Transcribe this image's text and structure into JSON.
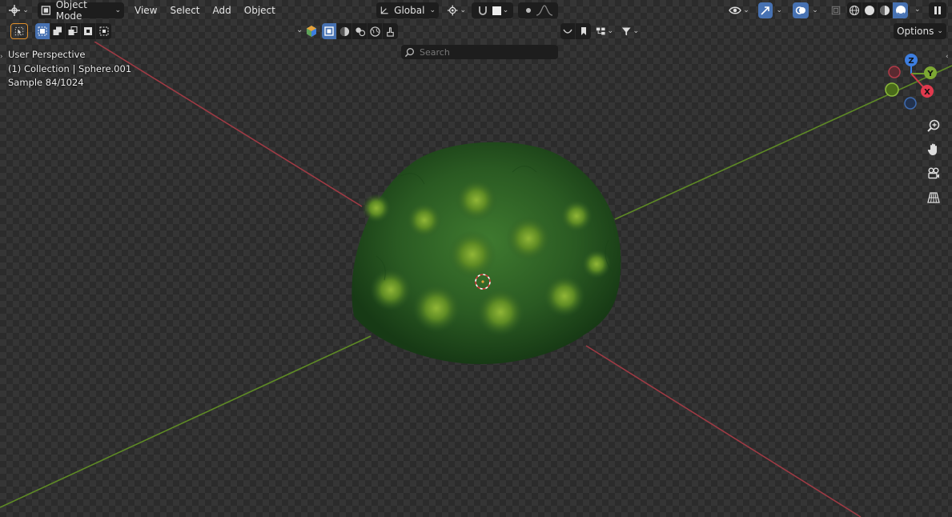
{
  "header": {
    "mode_select": {
      "value": "Object Mode"
    },
    "menus": [
      "View",
      "Select",
      "Add",
      "Object"
    ],
    "transform_orientation": {
      "value": "Global"
    },
    "options_label": "Options"
  },
  "toolbar": {
    "search": {
      "placeholder": "Search",
      "value": ""
    }
  },
  "viewport": {
    "overlay": {
      "perspective": "User Perspective",
      "collection": "(1) Collection | Sphere.001",
      "sample": "Sample 84/1024"
    },
    "gizmo": {
      "z_label": "Z",
      "y_label": "Y",
      "x_label": "X"
    },
    "object_name": "Sphere.001"
  },
  "colors": {
    "accent": "#4772b3",
    "axis_x": "#b23a48",
    "axis_y": "#6b9a2a",
    "axis_z": "#3d7ee0",
    "foliage": "#2c5a23"
  },
  "icons": [
    "editor-type-icon",
    "object-mode-icon",
    "orientation-icon",
    "pivot-icon",
    "snap-icon",
    "proportional-edit-icon",
    "falloff-icon",
    "visibility-icon",
    "gizmo-icon",
    "overlay-icon",
    "xray-icon",
    "wireframe-shading-icon",
    "solid-shading-icon",
    "material-shading-icon",
    "rendered-shading-icon",
    "zoom-icon",
    "pan-hand-icon",
    "camera-view-icon",
    "grid-ortho-icon"
  ]
}
